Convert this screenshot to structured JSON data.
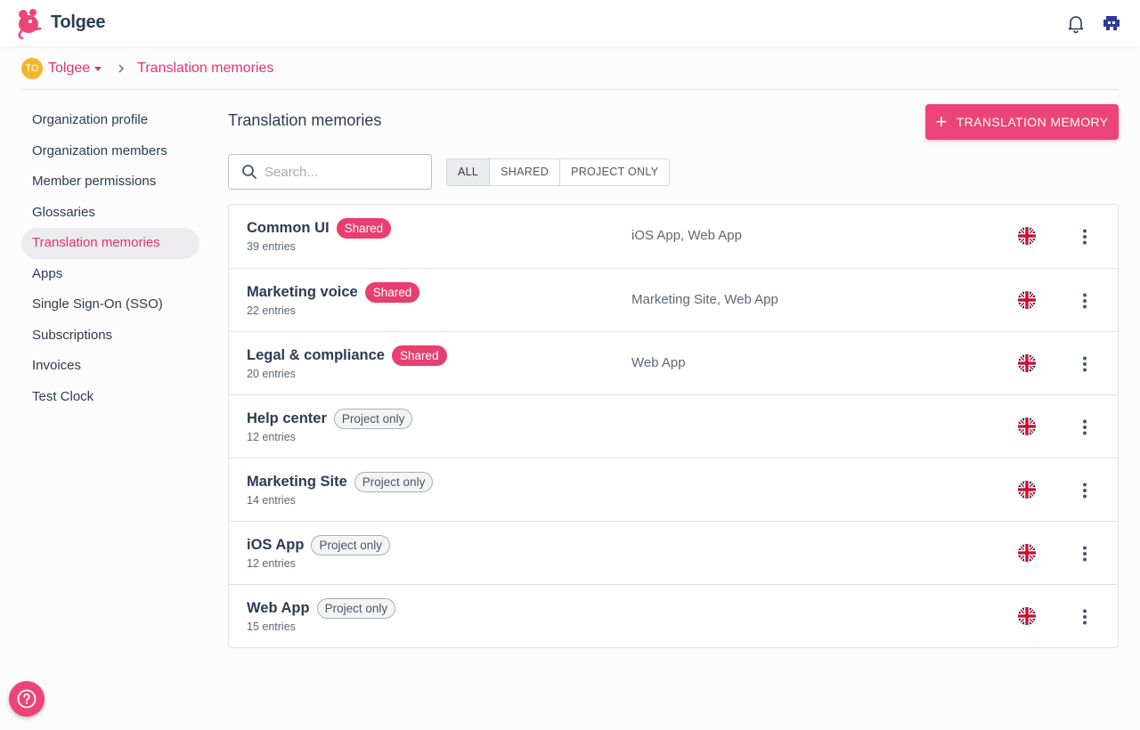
{
  "app": {
    "brand": "Tolgee"
  },
  "breadcrumb": {
    "org_initials": "TO",
    "org_name": "Tolgee",
    "current": "Translation memories"
  },
  "sidebar": {
    "items": [
      {
        "label": "Organization profile"
      },
      {
        "label": "Organization members"
      },
      {
        "label": "Member permissions"
      },
      {
        "label": "Glossaries"
      },
      {
        "label": "Translation memories",
        "active": true
      },
      {
        "label": "Apps"
      },
      {
        "label": "Single Sign-On (SSO)"
      },
      {
        "label": "Subscriptions"
      },
      {
        "label": "Invoices"
      },
      {
        "label": "Test Clock"
      }
    ]
  },
  "main": {
    "title": "Translation memories",
    "add_button_label": "TRANSLATION MEMORY",
    "search_placeholder": "Search...",
    "filters": [
      "ALL",
      "SHARED",
      "PROJECT ONLY"
    ],
    "active_filter": "ALL"
  },
  "memories": [
    {
      "name": "Common UI",
      "badge": "Shared",
      "badge_type": "shared",
      "entries": "39 entries",
      "projects": "iOS App, Web App"
    },
    {
      "name": "Marketing voice",
      "badge": "Shared",
      "badge_type": "shared",
      "entries": "22 entries",
      "projects": "Marketing Site, Web App"
    },
    {
      "name": "Legal & compliance",
      "badge": "Shared",
      "badge_type": "shared",
      "entries": "20 entries",
      "projects": "Web App"
    },
    {
      "name": "Help center",
      "badge": "Project only",
      "badge_type": "project",
      "entries": "12 entries",
      "projects": ""
    },
    {
      "name": "Marketing Site",
      "badge": "Project only",
      "badge_type": "project",
      "entries": "14 entries",
      "projects": ""
    },
    {
      "name": "iOS App",
      "badge": "Project only",
      "badge_type": "project",
      "entries": "12 entries",
      "projects": ""
    },
    {
      "name": "Web App",
      "badge": "Project only",
      "badge_type": "project",
      "entries": "15 entries",
      "projects": ""
    }
  ],
  "colors": {
    "accent": "#ec4479",
    "org_avatar": "#f5b52b",
    "text": "#2c3c52"
  },
  "icons": {
    "bell": "bell-icon",
    "flag": "uk-flag-icon",
    "more": "more-vertical-icon",
    "help": "help-icon",
    "search": "search-icon"
  }
}
